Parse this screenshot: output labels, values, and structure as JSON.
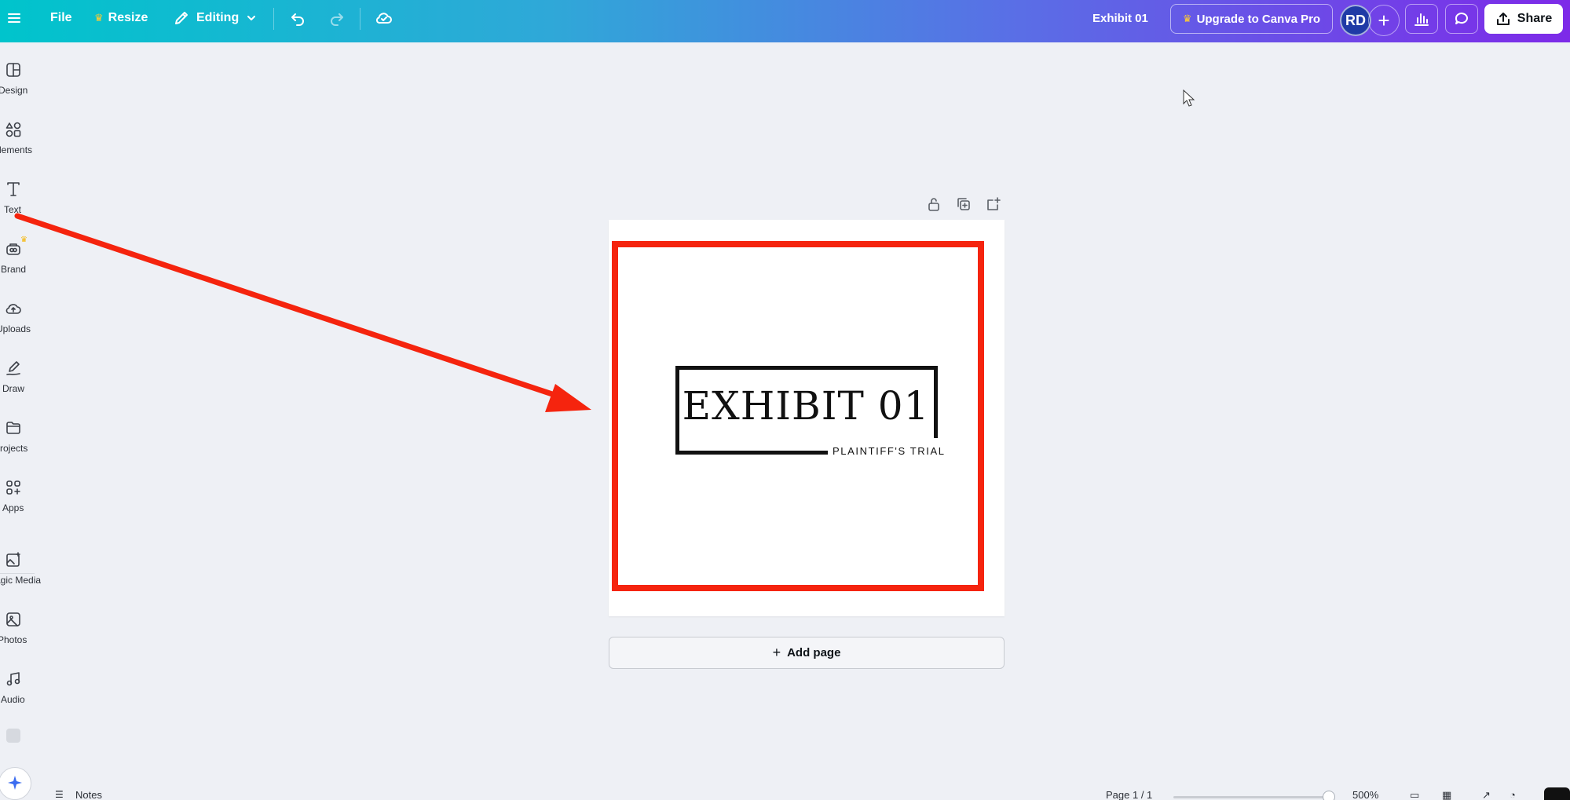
{
  "topbar": {
    "file_label": "File",
    "resize_label": "Resize",
    "editing_label": "Editing",
    "doc_title": "Exhibit 01",
    "upgrade_label": "Upgrade to Canva Pro",
    "avatar_initials": "RD",
    "share_label": "Share"
  },
  "sidebar": {
    "items": [
      {
        "label": "Design",
        "icon": "design-icon"
      },
      {
        "label": "Elements",
        "icon": "elements-icon"
      },
      {
        "label": "Text",
        "icon": "text-icon"
      },
      {
        "label": "Brand",
        "icon": "brand-icon"
      },
      {
        "label": "Uploads",
        "icon": "uploads-icon"
      },
      {
        "label": "Draw",
        "icon": "draw-icon"
      },
      {
        "label": "Projects",
        "icon": "projects-icon"
      },
      {
        "label": "Apps",
        "icon": "apps-icon"
      },
      {
        "label": "Magic Media",
        "icon": "magic-media-icon"
      },
      {
        "label": "Photos",
        "icon": "photos-icon"
      },
      {
        "label": "Audio",
        "icon": "audio-icon"
      }
    ]
  },
  "canvas": {
    "logo_title": "EXHIBIT 01",
    "logo_subtitle": "PLAINTIFF'S TRIAL",
    "add_page_label": "Add page"
  },
  "bottombar": {
    "notes_label": "Notes",
    "page_indicator": "Page 1 / 1",
    "zoom_level": "500%"
  },
  "colors": {
    "annotation_red": "#f5240e",
    "topbar_start": "#00c4cc",
    "topbar_end": "#7d2ae8"
  }
}
